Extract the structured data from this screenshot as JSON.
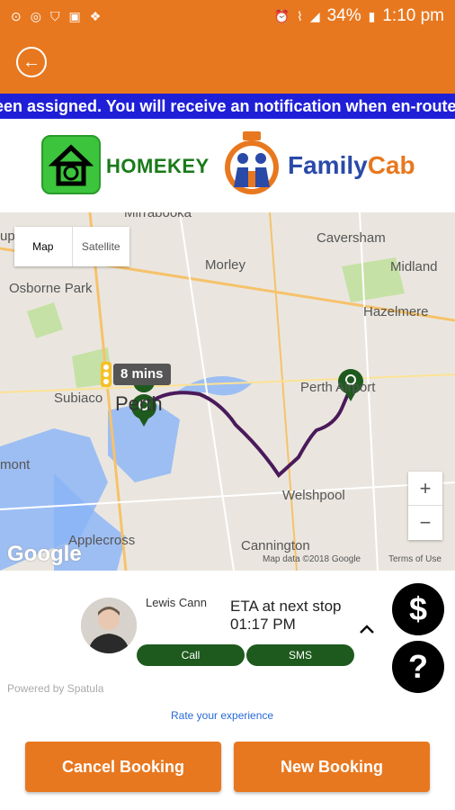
{
  "status_bar": {
    "battery": "34%",
    "time": "1:10 pm"
  },
  "banner": {
    "text": "een assigned. You will receive an notification when en-route"
  },
  "logos": {
    "homekey": "HOMEKEY",
    "family": "Family",
    "cab": "Cab"
  },
  "map": {
    "map_label": "Map",
    "satellite_label": "Satellite",
    "eta_bubble": "8 mins",
    "google": "Google",
    "credit": "Map data ©2018 Google",
    "terms": "Terms of Use",
    "places": [
      {
        "name": "Mirrabooka"
      },
      {
        "name": "Caversham"
      },
      {
        "name": "Morley"
      },
      {
        "name": "Midland"
      },
      {
        "name": "Osborne Park"
      },
      {
        "name": "Hazelmere"
      },
      {
        "name": "Subiaco"
      },
      {
        "name": "Perth"
      },
      {
        "name": "Perth Airport"
      },
      {
        "name": "Welshpool"
      },
      {
        "name": "Applecross"
      },
      {
        "name": "Cannington"
      },
      {
        "name": "mont"
      },
      {
        "name": "up"
      }
    ]
  },
  "driver": {
    "name": "Lewis Cann",
    "eta_label": "ETA at next stop",
    "eta_time": "01:17 PM",
    "call": "Call",
    "sms": "SMS"
  },
  "powered_by": "Powered by Spatula",
  "rate_link": "Rate your experience",
  "actions": {
    "cancel": "Cancel Booking",
    "new": "New Booking"
  },
  "colors": {
    "accent": "#e8781f",
    "banner": "#1f1fd8",
    "pill": "#1e5a1e",
    "route": "#4a1a5a"
  }
}
